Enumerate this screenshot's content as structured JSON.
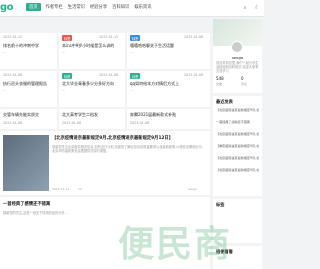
{
  "header": {
    "logo": "go",
    "nav": [
      "首页",
      "作者专栏",
      "生活常识",
      "经验分享",
      "百科知识",
      "娱乐资讯"
    ],
    "icons": [
      "search-icon",
      "moon-icon",
      "user-icon"
    ]
  },
  "cards": [
    {
      "date": "2023-01-12",
      "title": "排名前十的冲刺中学",
      "sub": "..."
    },
    {
      "date": "2023-01-15",
      "badge": "标签",
      "title": "本ins中9岁小时候是怎么训的",
      "sub": "..."
    },
    {
      "date": "2023-01-08",
      "badge": "标签",
      "title": "嘻嘻哈哈聊关于生活话题",
      "sub": "..."
    },
    {
      "date": "2023-01-08",
      "title": "执行员头衣服的管理报告",
      "sub": "..."
    },
    {
      "date": "2023-01-08",
      "badge": "标签",
      "title": "北大毕业青春多少分多好方向",
      "sub": "..."
    },
    {
      "date": "2023-01-08",
      "badge": "标签",
      "title": "qq如何给本方对情侣方式上",
      "sub": "..."
    },
    {
      "date": "2023-01-08",
      "title": "交管车辆先能实质交",
      "sub": "..."
    },
    {
      "date": "2023-01-08",
      "badge": "标签",
      "title": "北大高考学生二档发",
      "sub": "..."
    },
    {
      "date": "2023-01-08",
      "badge": "标签",
      "title": "奔腾2021届最新款式补贴",
      "sub": "..."
    }
  ],
  "featured": {
    "title": "【北京疫情进京最新规定9月,北京疫情进京最新规定9月12日】",
    "body": "感谢您关注北京疫情相关信息,如有出行计划,请提前了解北京目前防疫要求以及最新政策,以便安全顺利出行。北京市防疫政策也会根据情况实时调整。",
    "date": "2022-11-11",
    "author": "seogo",
    "views": "12",
    "likes": "0"
  },
  "second": {
    "title": "一首经典了感情还不错离",
    "body": "感谢您的关注,这是一段关于情感的经历分享..."
  },
  "sidebar": {
    "profile_name": "seogo",
    "profile_bio": "欢迎来到这里,我们一起分享生活经验和百科知识,欢迎大家来交流学习",
    "stats": [
      {
        "value": "548",
        "label": "文章"
      },
      {
        "value": "0",
        "label": "评论"
      }
    ],
    "latest_title": "最近发表",
    "latest": [
      "【北京疫情进京最新规定9月,北京疫",
      "一首经典了感情还不错离",
      "【北京疫情进京最新规定9月,北京疫",
      "【重庆疫情进京最新规定9月,北京疫",
      "【北京疫情进京最新规定9月,北京疫",
      "【北京疫情进京最新规定9月,北京疫"
    ],
    "tags_title": "标签",
    "links_title": "随便看看"
  },
  "watermark": "便民商"
}
